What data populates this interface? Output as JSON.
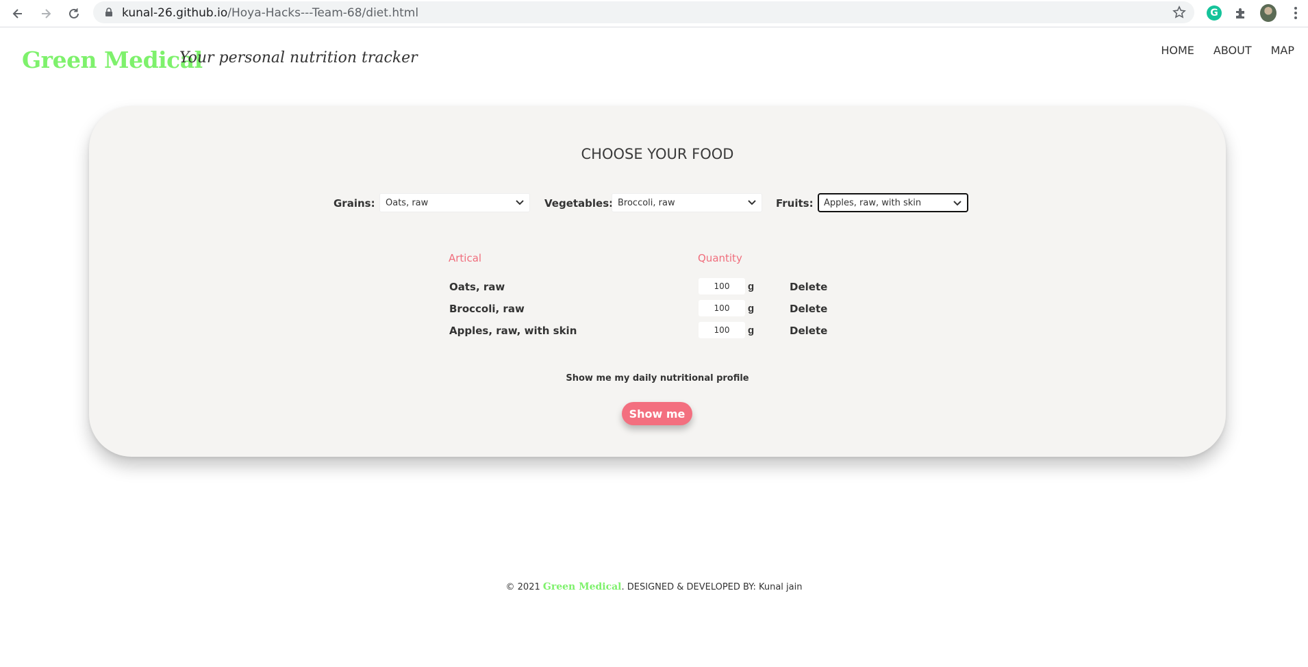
{
  "browser": {
    "url_host": "kunal-26.github.io",
    "url_path": "/Hoya-Hacks---Team-68/diet.html",
    "extension_letter": "G"
  },
  "header": {
    "brand": "Green Medical",
    "tagline": "Your personal nutrition tracker",
    "nav": [
      "HOME",
      "ABOUT",
      "MAP"
    ]
  },
  "main": {
    "title": "CHOOSE YOUR FOOD",
    "selectors": [
      {
        "label": "Grains:",
        "value": "Oats, raw"
      },
      {
        "label": "Vegetables:",
        "value": "Broccoli, raw"
      },
      {
        "label": "Fruits:",
        "value": "Apples, raw, with skin"
      }
    ],
    "table": {
      "headers": [
        "Artical",
        "Quantity"
      ],
      "rows": [
        {
          "name": "Oats, raw",
          "qty": "100",
          "unit": "g",
          "action": "Delete"
        },
        {
          "name": "Broccoli, raw",
          "qty": "100",
          "unit": "g",
          "action": "Delete"
        },
        {
          "name": "Apples, raw, with skin",
          "qty": "100",
          "unit": "g",
          "action": "Delete"
        }
      ]
    },
    "profile_text": "Show me my daily nutritional profile",
    "show_button": "Show me"
  },
  "footer": {
    "copyright": "© 2021",
    "brand": "Green Medical",
    "credit": ". DESIGNED & DEVELOPED BY: Kunal jain"
  },
  "colors": {
    "brand": "#7ef16c",
    "accent": "#f36f7f"
  }
}
